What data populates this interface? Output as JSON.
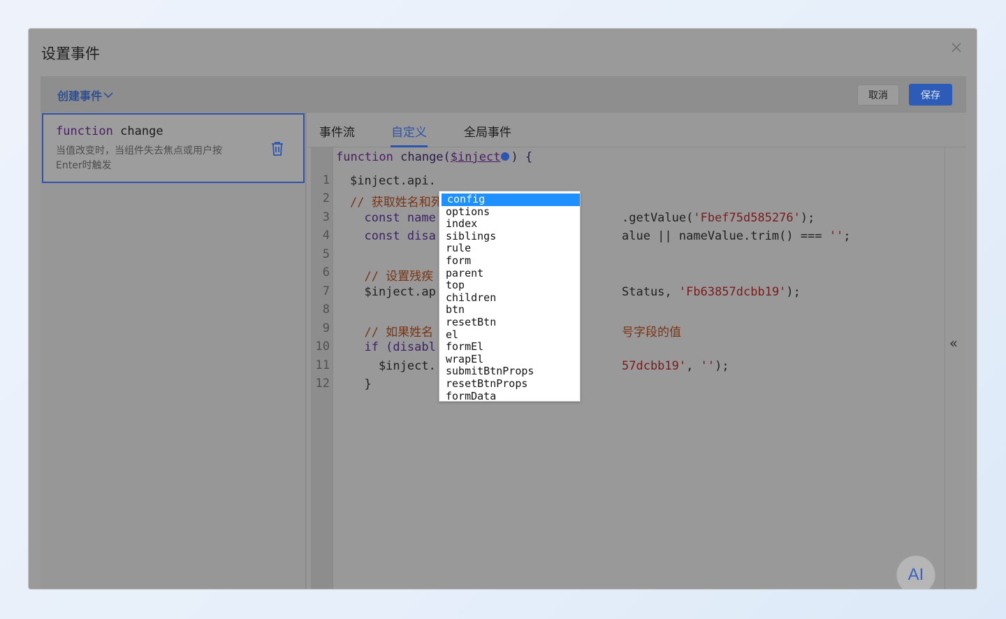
{
  "dialog": {
    "title": "设置事件",
    "close_icon": "close-icon"
  },
  "toolbar": {
    "create_event_label": "创建事件",
    "cancel_label": "取消",
    "save_label": "保存"
  },
  "event_list": {
    "items": [
      {
        "keyword": "function",
        "name": "change",
        "description": "当值改变时，当组件失去焦点或用户按Enter时触发"
      }
    ]
  },
  "tabs": [
    {
      "label": "事件流",
      "active": false
    },
    {
      "label": "自定义",
      "active": true
    },
    {
      "label": "全局事件",
      "active": false
    }
  ],
  "editor": {
    "header": {
      "keyword": "function",
      "signature_start": " change(",
      "param": "$inject",
      "signature_end": ") {"
    },
    "line_numbers": [
      "1",
      "2",
      "3",
      "4",
      "5",
      "6",
      "7",
      "8",
      "9",
      "10",
      "11",
      "12"
    ],
    "lines": [
      {
        "text": "$inject.api.",
        "type": "code"
      },
      {
        "text": "// 获取姓名和死",
        "type": "comment"
      },
      {
        "text": "  const name",
        "type": "kw",
        "tail": ".getValue('Fbef75d585276');"
      },
      {
        "text": "  const disa",
        "type": "kw",
        "tail": "alue || nameValue.trim() === '';"
      },
      {
        "text": "",
        "type": "code"
      },
      {
        "text": "  // 设置残疾",
        "type": "comment"
      },
      {
        "text": "  $inject.ap",
        "type": "code",
        "tail": "Status, 'Fb63857dcbb19');"
      },
      {
        "text": "",
        "type": "code"
      },
      {
        "text": "  // 如果姓名",
        "type": "comment",
        "tail": "号字段的值"
      },
      {
        "text": "  if (disabl",
        "type": "kw",
        "tail": ""
      },
      {
        "text": "    $inject.",
        "type": "code",
        "tail": "57dcbb19', '');"
      },
      {
        "text": "  }",
        "type": "code"
      }
    ]
  },
  "autocomplete": {
    "items": [
      "config",
      "options",
      "index",
      "siblings",
      "rule",
      "form",
      "parent",
      "top",
      "children",
      "btn",
      "resetBtn",
      "el",
      "formEl",
      "wrapEl",
      "submitBtnProps",
      "resetBtnProps",
      "formData"
    ],
    "selected_index": 0
  },
  "ai_button_label": "AI",
  "collapse_label": "«",
  "colors": {
    "accent": "#2b55b0",
    "save_bg": "#2d5bb8",
    "selection": "#1e90ff"
  }
}
